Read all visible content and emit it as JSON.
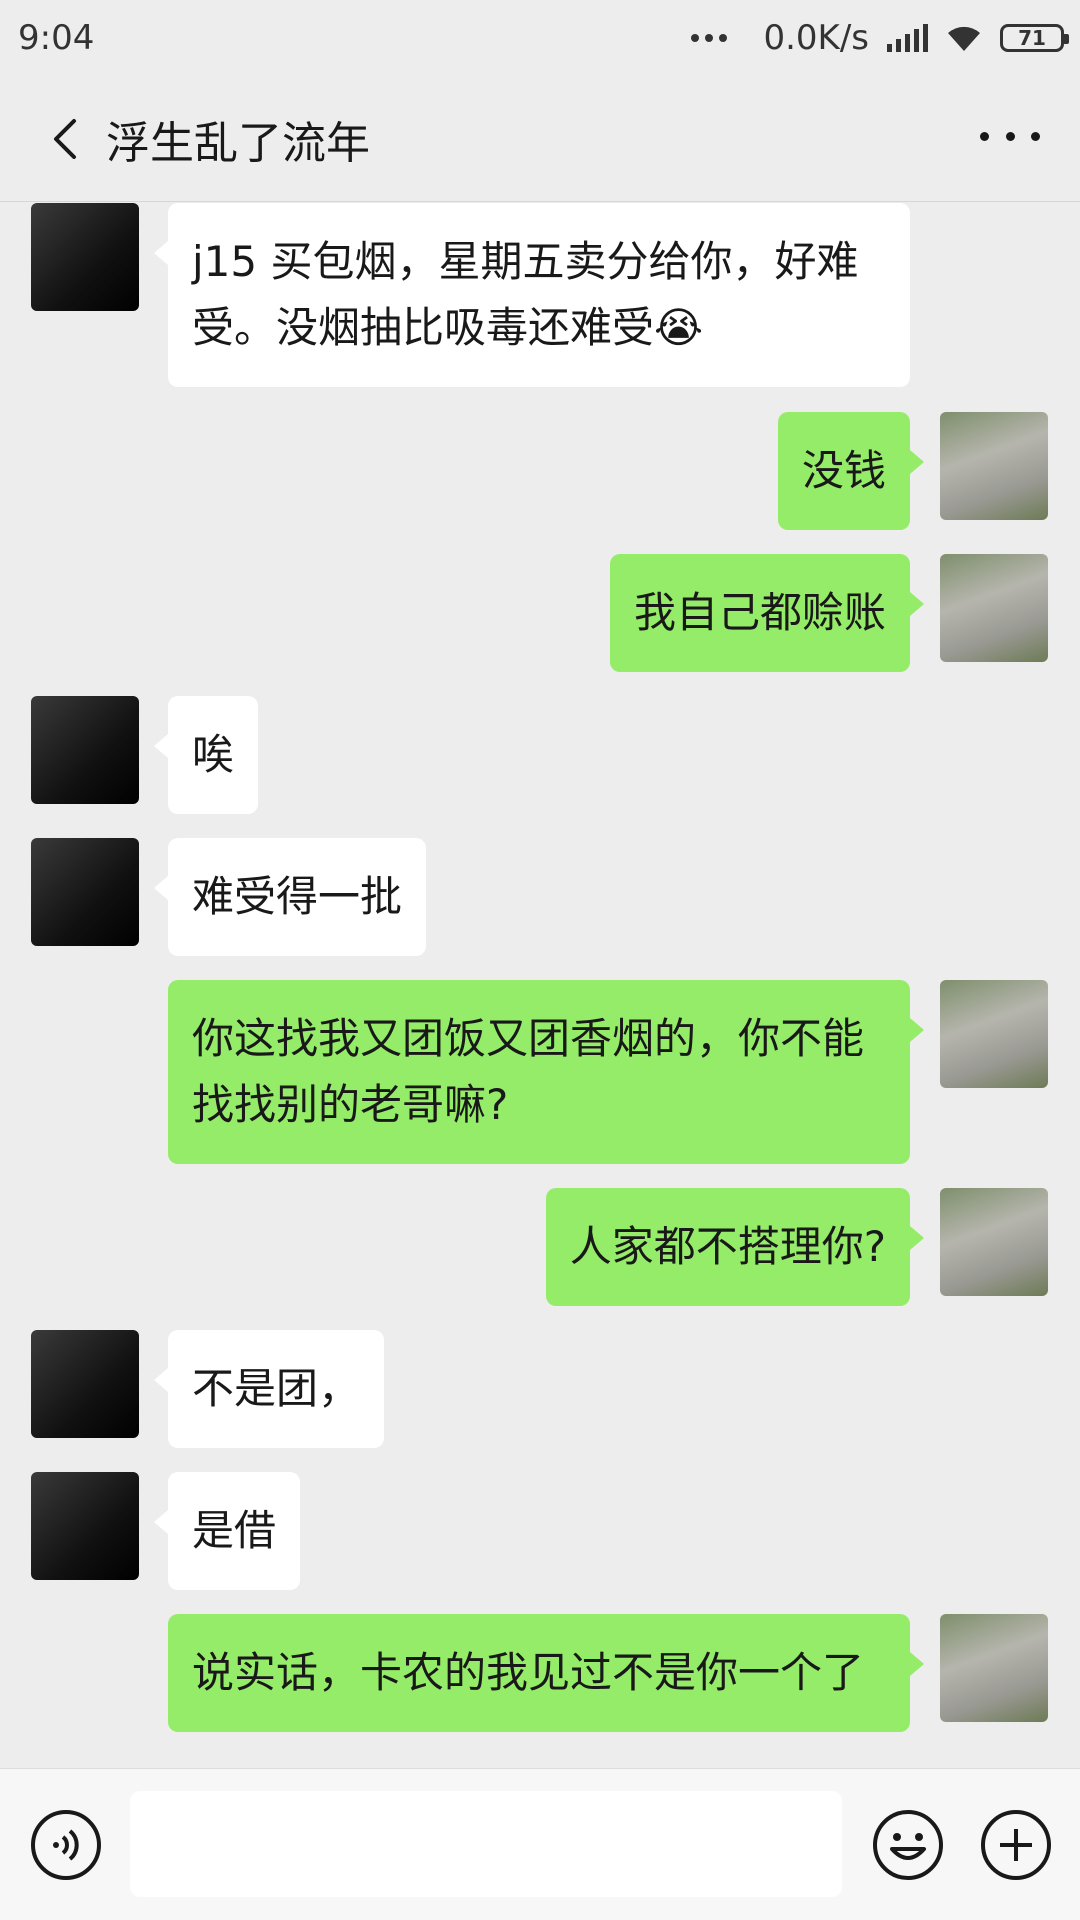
{
  "status_bar": {
    "time": "9:04",
    "network_speed": "0.0K/s",
    "battery_level": "71"
  },
  "header": {
    "title": "浮生乱了流年"
  },
  "messages": [
    {
      "sender": "them",
      "text": "j15 买包烟，星期五卖分给你，好难受。没烟抽比吸毒还难受😭"
    },
    {
      "sender": "me",
      "text": "没钱"
    },
    {
      "sender": "me",
      "text": "我自己都赊账"
    },
    {
      "sender": "them",
      "text": "唉"
    },
    {
      "sender": "them",
      "text": "难受得一批"
    },
    {
      "sender": "me",
      "text": "你这找我又团饭又团香烟的，你不能找找别的老哥嘛?"
    },
    {
      "sender": "me",
      "text": "人家都不搭理你?"
    },
    {
      "sender": "them",
      "text": "不是团，"
    },
    {
      "sender": "them",
      "text": "是借"
    },
    {
      "sender": "me",
      "text": "说实话，卡农的我见过不是你一个了"
    }
  ],
  "colors": {
    "background": "#ededed",
    "my_bubble": "#95ec69",
    "their_bubble": "#ffffff"
  },
  "icons": [
    "back-arrow-icon",
    "more-icon",
    "voice-icon",
    "emoji-icon",
    "plus-icon",
    "wifi-icon",
    "signal-icon",
    "battery-icon"
  ]
}
